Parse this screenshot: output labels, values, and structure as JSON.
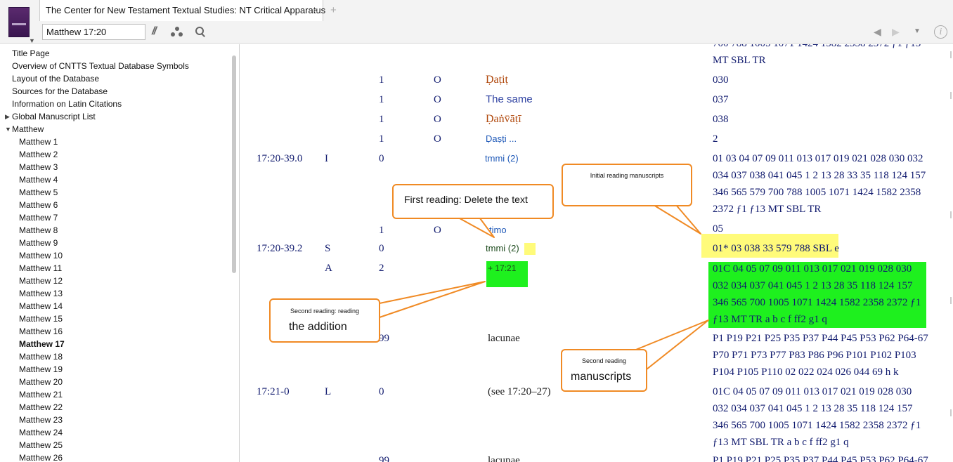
{
  "tab": {
    "title": "The Center for New Testament Textual Studies: NT Critical Apparatus",
    "close": "×",
    "add": "+"
  },
  "toolbar": {
    "reference": "Matthew 17:20",
    "parallel": "//"
  },
  "nav": {
    "back": "◀",
    "forward": "▶",
    "menu": "▼",
    "info": "i"
  },
  "sidebar": {
    "items": [
      {
        "label": "Title Page",
        "level": 0
      },
      {
        "label": "Overview of CNTTS Textual Database Symbols",
        "level": 0
      },
      {
        "label": "Layout of the Database",
        "level": 0
      },
      {
        "label": "Sources for the Database",
        "level": 0
      },
      {
        "label": "Information on Latin Citations",
        "level": 0
      },
      {
        "label": "Global Manuscript List",
        "level": 0,
        "expander": "▶"
      },
      {
        "label": "Matthew",
        "level": 0,
        "expander": "▼"
      },
      {
        "label": "Matthew 1",
        "level": 1
      },
      {
        "label": "Matthew 2",
        "level": 1
      },
      {
        "label": "Matthew 3",
        "level": 1
      },
      {
        "label": "Matthew 4",
        "level": 1
      },
      {
        "label": "Matthew 5",
        "level": 1
      },
      {
        "label": "Matthew 6",
        "level": 1
      },
      {
        "label": "Matthew 7",
        "level": 1
      },
      {
        "label": "Matthew 8",
        "level": 1
      },
      {
        "label": "Matthew 9",
        "level": 1
      },
      {
        "label": "Matthew 10",
        "level": 1
      },
      {
        "label": "Matthew 11",
        "level": 1
      },
      {
        "label": "Matthew 12",
        "level": 1
      },
      {
        "label": "Matthew 13",
        "level": 1
      },
      {
        "label": "Matthew 14",
        "level": 1
      },
      {
        "label": "Matthew 15",
        "level": 1
      },
      {
        "label": "Matthew 16",
        "level": 1
      },
      {
        "label": "Matthew 17",
        "level": 1,
        "bold": true
      },
      {
        "label": "Matthew 18",
        "level": 1
      },
      {
        "label": "Matthew 19",
        "level": 1
      },
      {
        "label": "Matthew 20",
        "level": 1
      },
      {
        "label": "Matthew 21",
        "level": 1
      },
      {
        "label": "Matthew 22",
        "level": 1
      },
      {
        "label": "Matthew 23",
        "level": 1
      },
      {
        "label": "Matthew 24",
        "level": 1
      },
      {
        "label": "Matthew 25",
        "level": 1
      },
      {
        "label": "Matthew 26",
        "level": 1
      }
    ]
  },
  "apparatus": {
    "top_ms_1": "700 788 1005 1071 1424 1582 2358 2372 ƒ1 ƒ13",
    "top_ms_2": "MT SBL TR",
    "r1": {
      "n": "1",
      "o": "O",
      "reading": "Ḍaṭiṭ",
      "ms": "030"
    },
    "r2": {
      "n": "1",
      "o": "O",
      "reading": "The same",
      "ms": "037"
    },
    "r3": {
      "n": "1",
      "o": "O",
      "reading": "Ḍaṅv̄āṭī",
      "ms": "038"
    },
    "r4": {
      "n": "1",
      "o": "O",
      "reading": "Ḍaṣṭi ...",
      "ms": "2"
    },
    "r5": {
      "ref": "17:20-39.0",
      "type": "I",
      "n": "0",
      "reading": "tmmi (2)",
      "ms": "01 03 04 07 09 011 013 017 019 021 028 030 032 034 037 038 041 045 1 2 13 28 33 35 118 124 157 346 565 579 700 788 1005 1071 1424 1582 2358 2372 ƒ1 ƒ13 MT SBL TR"
    },
    "r6": {
      "n": "1",
      "o": "O",
      "reading": "timo",
      "ms": "05"
    },
    "r7": {
      "ref": "17:20-39.2",
      "type": "S",
      "n": "0",
      "reading": "tmmi (2)",
      "ms": "01* 03 038 33 579 788 SBL e"
    },
    "r8": {
      "type": "A",
      "n": "2",
      "reading": "+ 17:21",
      "ms": "01C 04 05 07 09 011 013 017 021 019 028 030 032 034 037 041 045 1 2 13 28 35 118 124 157 346 565 700 1005 1071 1424 1582 2358 2372 ƒ1 ƒ13 MT TR a b c f ff2 g1 q"
    },
    "r9": {
      "n": "99",
      "reading": "lacunae",
      "ms": "P1 P19 P21 P25 P35 P37 P44 P45 P53 P62 P64-67 P70 P71 P73 P77 P83 P86 P96 P101 P102 P103 P104 P105 P110 02 022 024 026 044 69 h k"
    },
    "r10": {
      "ref": "17:21-0",
      "type": "L",
      "n": "0",
      "reading": "(see 17:20–27)",
      "ms": "01C 04 05 07 09 011 013 017 021 019 028 030 032 034 037 041 045 1 2 13 28 35 118 124 157 346 565 700 1005 1071 1424 1582 2358 2372 ƒ1 ƒ13 MT SBL TR a b c f ff2 g1 q"
    },
    "r11": {
      "n": "99",
      "reading": "lacunae",
      "ms": "P1 P19 P21 P25 P35 P37 P44 P45 P53 P62 P64-67"
    }
  },
  "callouts": {
    "first_reading": "First reading: Delete the text",
    "initial_ms": "Initial reading manuscripts",
    "second_reading_small": "Second reading: reading",
    "second_reading_big": "the addition",
    "second_ms_small": "Second reading",
    "second_ms_big": "manuscripts"
  },
  "colors": {
    "callout_border": "#f08a24",
    "highlight_yellow": "#fffb7a",
    "highlight_green": "#1ef01e",
    "text_navy": "#101a6e"
  }
}
